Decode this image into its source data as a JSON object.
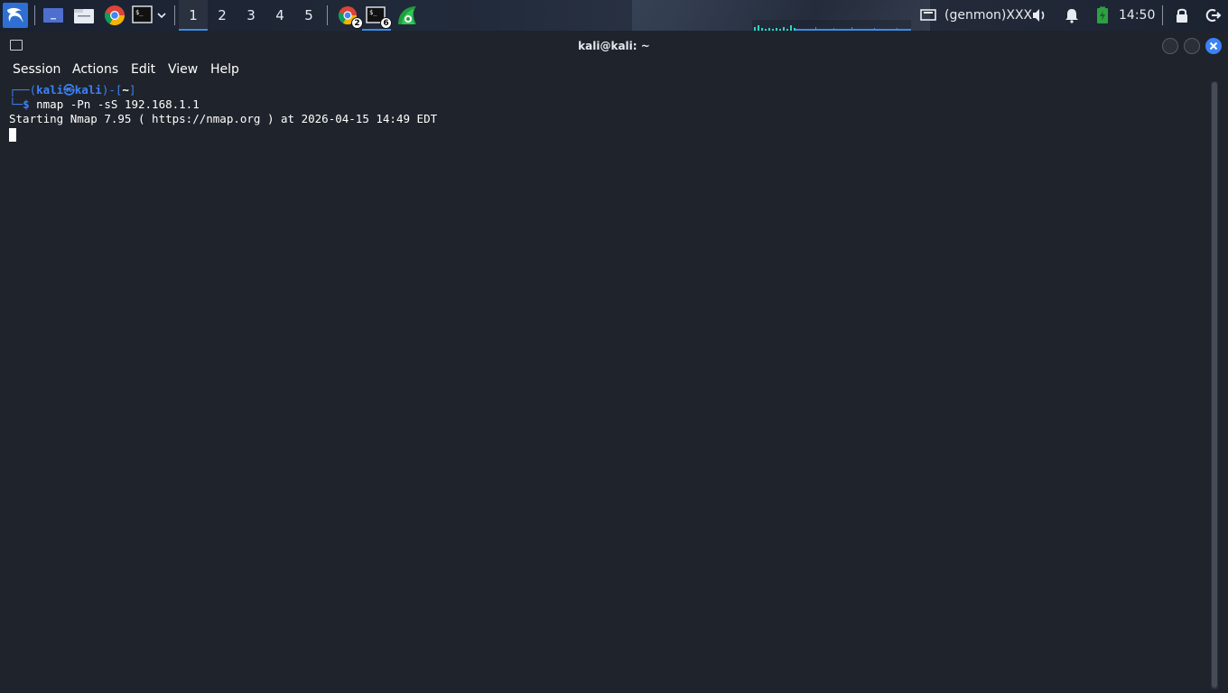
{
  "panel": {
    "workspaces": [
      "1",
      "2",
      "3",
      "4",
      "5"
    ],
    "active_workspace": "1",
    "tasks": [
      {
        "name": "Chrome",
        "badge": "2"
      },
      {
        "name": "Terminal",
        "badge": "6"
      },
      {
        "name": "Wireshark",
        "badge": ""
      }
    ],
    "genmon_text": "(genmon)XXX",
    "clock": "14:50",
    "accent_color": "#3b8be8"
  },
  "window": {
    "title": "kali@kali: ~",
    "menu": [
      "Session",
      "Actions",
      "Edit",
      "View",
      "Help"
    ]
  },
  "terminal": {
    "prompt": {
      "open_bracket_prefix": "┌──(",
      "user": "kali",
      "at_symbol": "㉿",
      "host": "kali",
      "mid": ")-[",
      "dir": "~",
      "close": "]",
      "second_prefix": "└─",
      "dollar": "$"
    },
    "command": " nmap -Pn -sS 192.168.1.1",
    "output": [
      "Starting Nmap 7.95 ( https://nmap.org ) at 2026-04-15 14:49 EDT"
    ]
  }
}
